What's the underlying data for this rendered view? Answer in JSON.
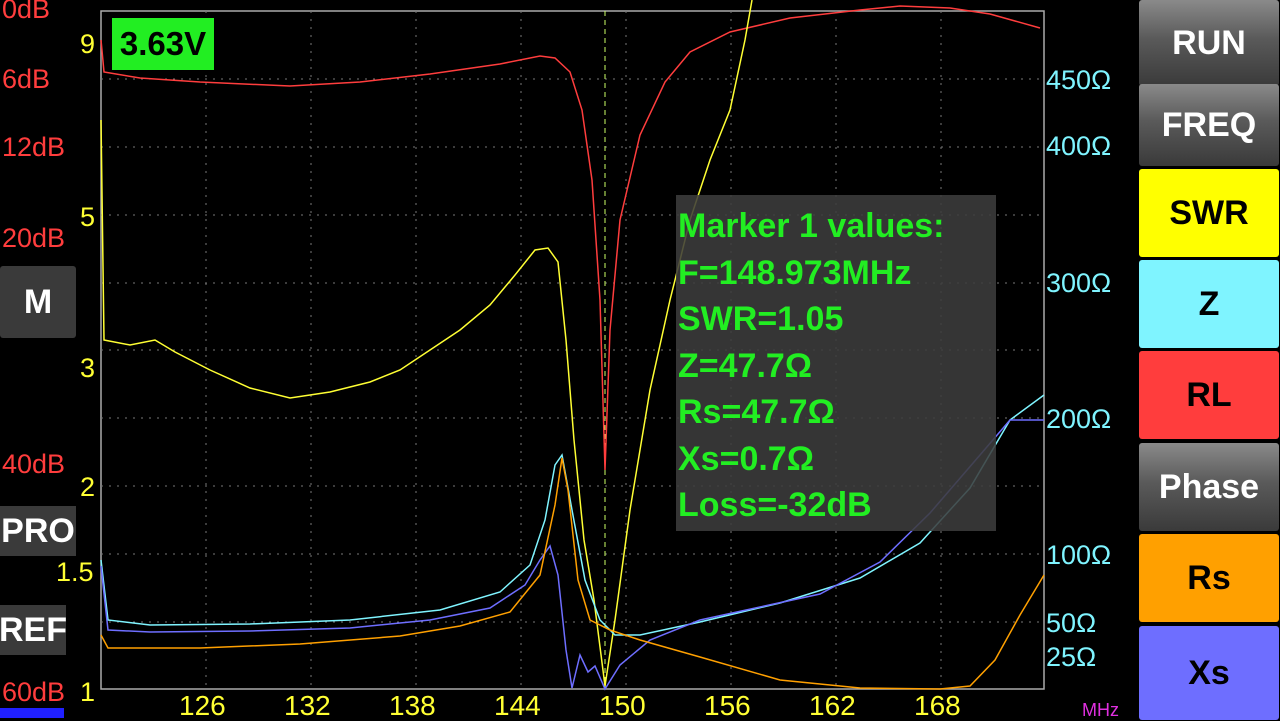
{
  "plot": {
    "rl_labels": [
      "0dB",
      "6dB",
      "12dB",
      "20dB",
      "40dB",
      "60dB"
    ],
    "swr_labels": [
      "9",
      "5",
      "3",
      "2",
      "1.5",
      "1"
    ],
    "z_labels": [
      "450Ω",
      "400Ω",
      "300Ω",
      "200Ω",
      "100Ω",
      "50Ω",
      "25Ω"
    ],
    "x_ticks": [
      "126",
      "132",
      "138",
      "144",
      "150",
      "156",
      "162",
      "168"
    ],
    "x_unit": "MHz",
    "marker_freq_mhz": 148.973,
    "colors": {
      "swr": "#ffff33",
      "z": "#7ff4ff",
      "rl": "#ff3d3d",
      "rs": "#ffa000",
      "xs": "#6e6eff",
      "marker": "#22ee22"
    }
  },
  "voltage": "3.63V",
  "marker": {
    "title": "Marker 1 values:",
    "freq": "F=148.973MHz",
    "swr": "SWR=1.05",
    "z": "Z=47.7Ω",
    "rs": "Rs=47.7Ω",
    "xs": "Xs=0.7Ω",
    "loss": "Loss=-32dB"
  },
  "left_buttons": {
    "m": "M",
    "pro": "PRO",
    "ref": "REF"
  },
  "right_buttons": {
    "run": "RUN",
    "freq": "FREQ",
    "swr": "SWR",
    "z": "Z",
    "rl": "RL",
    "phase": "Phase",
    "rs": "Rs",
    "xs": "Xs"
  }
}
